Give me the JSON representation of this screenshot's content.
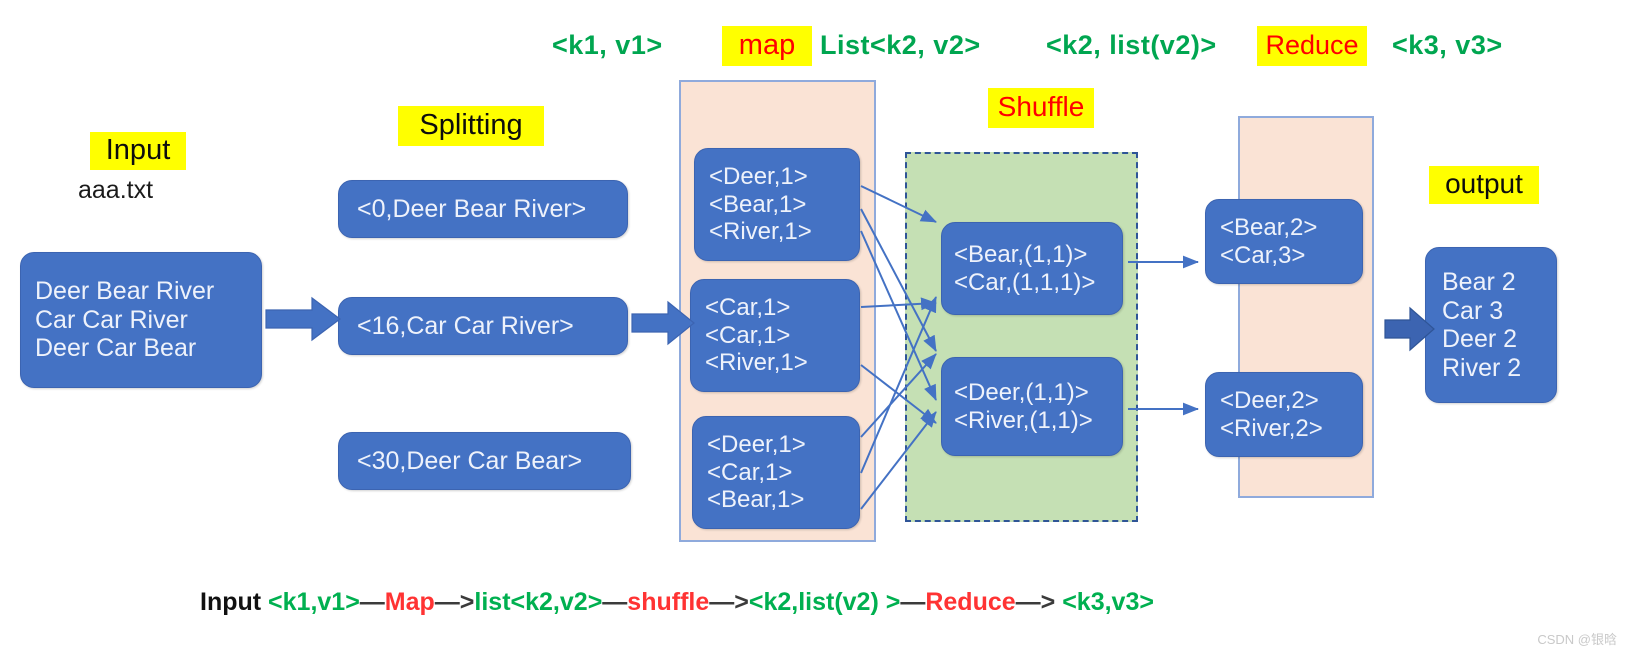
{
  "header": {
    "k1v1": "<k1, v1>",
    "map_label": "map",
    "list_k2v2": "List<k2, v2>",
    "k2_listv2": "<k2, list(v2)>",
    "reduce_label": "Reduce",
    "k3v3": "<k3, v3>"
  },
  "stages": {
    "input_label": "Input",
    "input_file": "aaa.txt",
    "splitting_label": "Splitting",
    "shuffle_label": "Shuffle",
    "output_label": "output"
  },
  "input_box": {
    "lines": [
      "Deer Bear River",
      "Car Car River",
      "Deer Car Bear"
    ]
  },
  "splitting_boxes": [
    {
      "text": "<0,Deer Bear River>"
    },
    {
      "text": "<16,Car Car River>"
    },
    {
      "text": "<30,Deer Car Bear>"
    }
  ],
  "mapping_boxes": [
    {
      "lines": [
        "<Deer,1>",
        "<Bear,1>",
        "<River,1>"
      ]
    },
    {
      "lines": [
        "<Car,1>",
        "<Car,1>",
        "<River,1>"
      ]
    },
    {
      "lines": [
        "<Deer,1>",
        "<Car,1>",
        "<Bear,1>"
      ]
    }
  ],
  "shuffle_boxes": [
    {
      "lines": [
        "<Bear,(1,1)>",
        "<Car,(1,1,1)>"
      ]
    },
    {
      "lines": [
        "<Deer,(1,1)>",
        "<River,(1,1)>"
      ]
    }
  ],
  "reduce_boxes": [
    {
      "lines": [
        "<Bear,2>",
        "<Car,3>"
      ]
    },
    {
      "lines": [
        "<Deer,2>",
        "<River,2>"
      ]
    }
  ],
  "output_box": {
    "lines": [
      "Bear 2",
      "Car 3",
      "Deer 2",
      "River 2"
    ]
  },
  "caption": {
    "p1": "Input ",
    "p2": "<k1,v1>",
    "p3": "—",
    "p4": "Map",
    "p5": "—>",
    "p6": "list<k2,v2>",
    "p7": "—",
    "p8": "shuffle",
    "p9": "—>",
    "p10": "<k2,list(v2) >",
    "p11": "—",
    "p12": "Reduce",
    "p13": "—> ",
    "p14": "<k3,v3>"
  },
  "watermark": "CSDN @银晗",
  "colors": {
    "box_blue": "#4472c4",
    "panel_peach": "#fae3d5",
    "panel_green": "#c5e0b4",
    "highlight": "#ffff00",
    "formula_green": "#00a650",
    "label_red": "#ff0000",
    "arrow_blue": "#4472c4",
    "thin_arrow": "#5b84c4"
  }
}
